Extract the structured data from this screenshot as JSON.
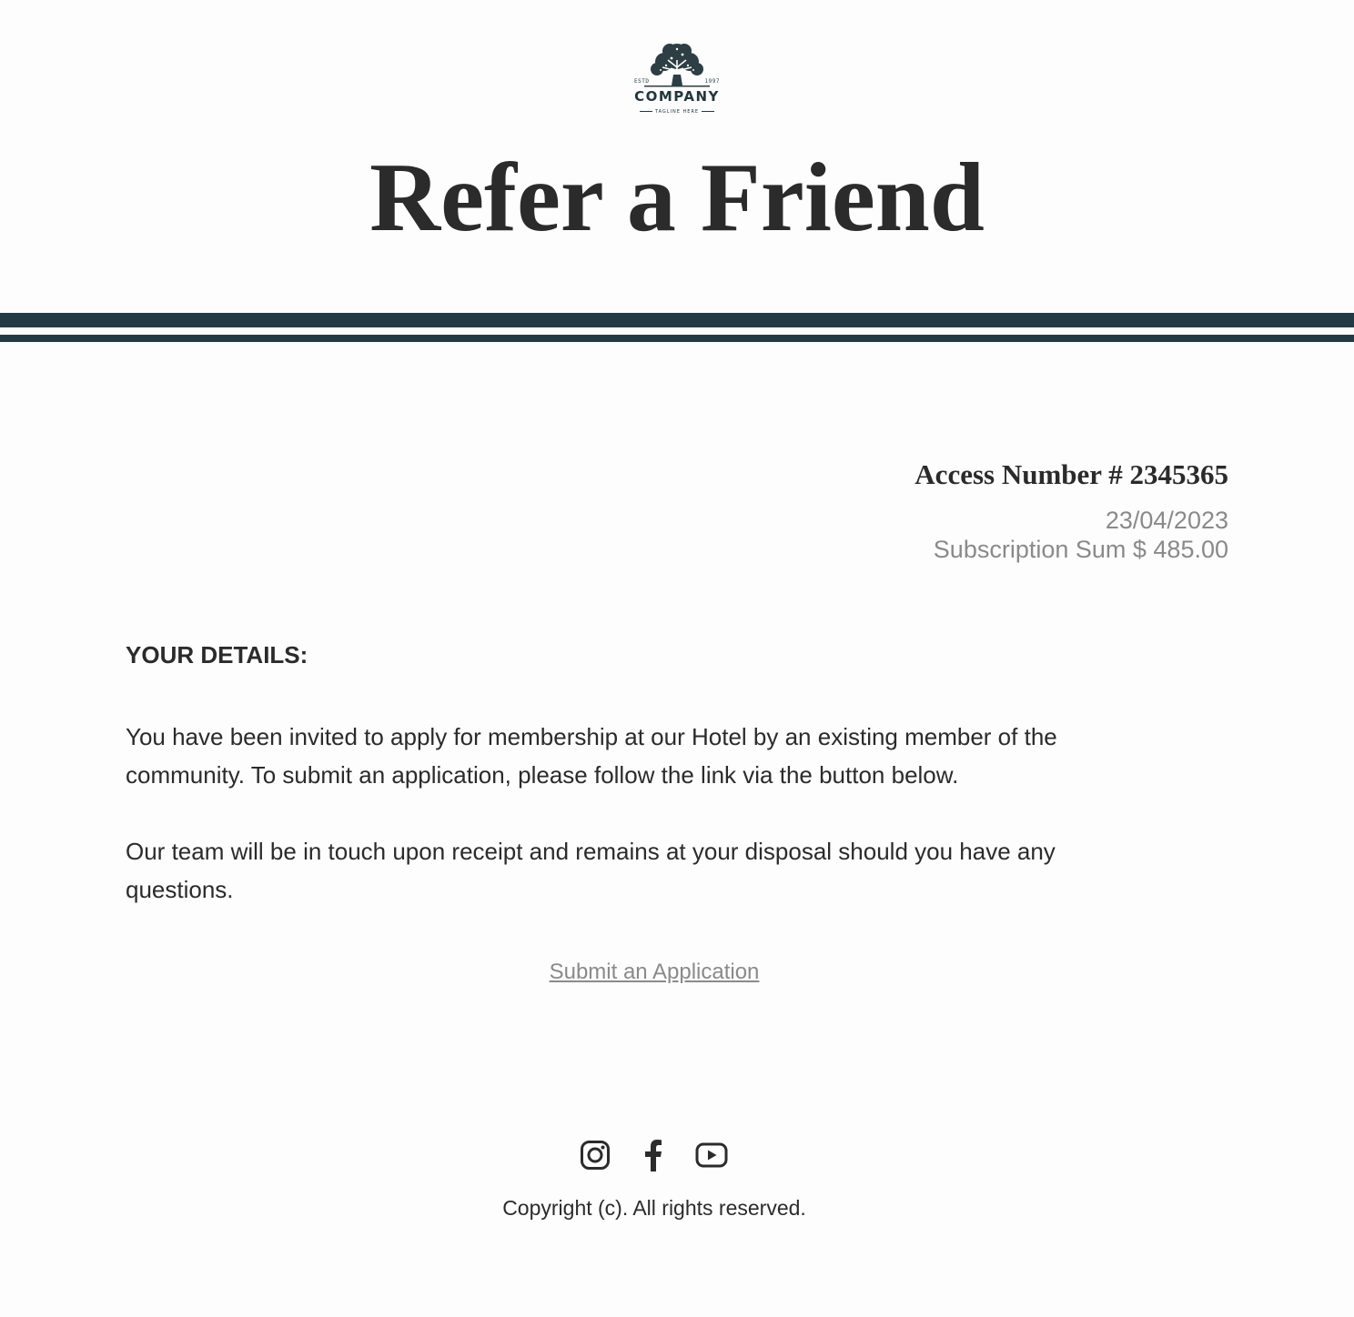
{
  "logo": {
    "estd": "ESTD",
    "year": "1997",
    "company": "COMPANY",
    "tagline": "TAGLINE HERE",
    "icon": "tree-icon"
  },
  "header": {
    "title": "Refer a Friend"
  },
  "summary": {
    "access_number": "Access Number # 2345365",
    "date": "23/04/2023",
    "subscription": "Subscription Sum $ 485.00"
  },
  "body": {
    "heading": "YOUR DETAILS:",
    "paragraph_1": "You have been invited to apply for membership at our Hotel by an existing member of the community. To submit an application, please follow the link via the button below.",
    "paragraph_2": "Our team will be in touch upon receipt and remains at your disposal should you have any questions.",
    "cta_label": "Submit an Application"
  },
  "footer": {
    "socials": [
      "instagram-icon",
      "facebook-icon",
      "youtube-icon"
    ],
    "copyright": "Copyright (c). All rights reserved."
  },
  "colors": {
    "brand_dark": "#233a44",
    "text": "#2b2b2b",
    "muted": "#8a8a8a",
    "background": "#fdfdfd"
  }
}
